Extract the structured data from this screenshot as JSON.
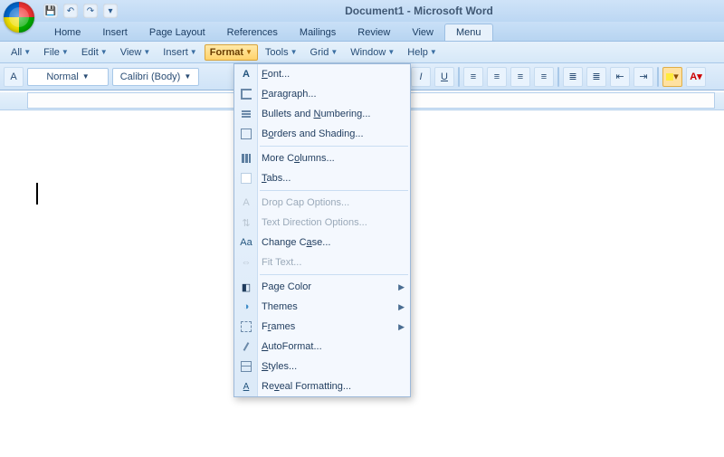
{
  "window": {
    "title": "Document1 - Microsoft Word"
  },
  "tabs": [
    "Home",
    "Insert",
    "Page Layout",
    "References",
    "Mailings",
    "Review",
    "View",
    "Menu"
  ],
  "active_tab": "Menu",
  "menubar": {
    "items": [
      "All",
      "File",
      "Edit",
      "View",
      "Insert",
      "Format",
      "Tools",
      "Grid",
      "Window",
      "Help"
    ],
    "open": "Format"
  },
  "toolbar": {
    "style_combo": "Normal",
    "font_combo": "Calibri (Body)"
  },
  "format_menu": [
    {
      "label": "Font...",
      "u": 0,
      "icon": "font-icon"
    },
    {
      "label": "Paragraph...",
      "u": 0,
      "icon": "paragraph-icon"
    },
    {
      "label": "Bullets and Numbering...",
      "u": 12,
      "icon": "list-icon"
    },
    {
      "label": "Borders and Shading...",
      "u": 1,
      "icon": "border-icon"
    },
    {
      "sep": true
    },
    {
      "label": "More Columns...",
      "u": 6,
      "icon": "columns-icon"
    },
    {
      "label": "Tabs...",
      "u": 0,
      "icon": "tabs-icon"
    },
    {
      "sep": true
    },
    {
      "label": "Drop Cap Options...",
      "disabled": true,
      "icon": "dropcap-icon"
    },
    {
      "label": "Text Direction Options...",
      "disabled": true,
      "icon": "direction-icon"
    },
    {
      "label": "Change Case...",
      "u": 8,
      "icon": "case-icon"
    },
    {
      "label": "Fit Text...",
      "disabled": true,
      "icon": "fittext-icon"
    },
    {
      "sep": true
    },
    {
      "label": "Page Color",
      "icon": "pagecolor-icon",
      "submenu": true
    },
    {
      "label": "Themes",
      "icon": "themes-icon",
      "submenu": true
    },
    {
      "label": "Frames",
      "u": 1,
      "icon": "frames-icon",
      "submenu": true
    },
    {
      "label": "AutoFormat...",
      "u": 0,
      "icon": "autoformat-icon"
    },
    {
      "label": "Styles...",
      "u": 0,
      "icon": "styles-icon"
    },
    {
      "label": "Reveal Formatting...",
      "u": 2,
      "icon": "reveal-icon"
    }
  ]
}
